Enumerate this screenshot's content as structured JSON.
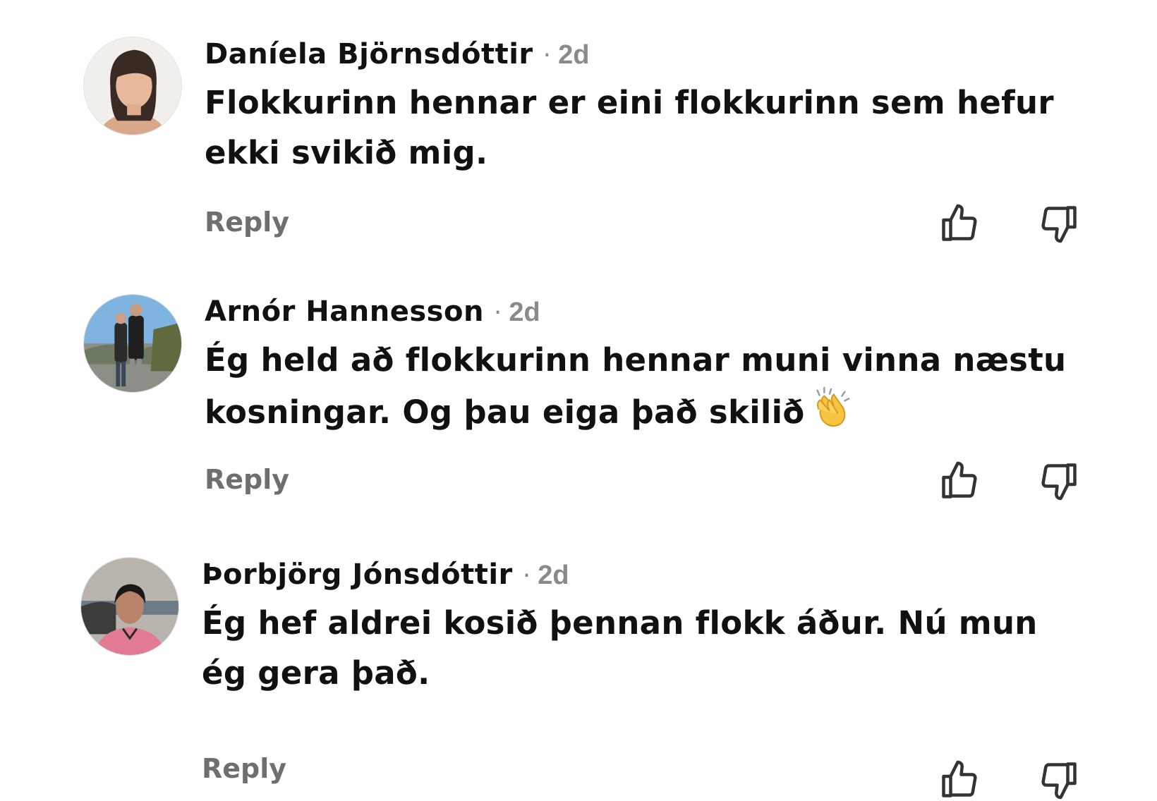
{
  "comments": [
    {
      "author": "Daníela Björnsdóttir",
      "separator": "·",
      "time": "2d",
      "text": "Flokkurinn hennar er eini flokkurinn sem hefur ekki svikið mig.",
      "reply_label": "Reply",
      "like_icon": "thumbs-up-icon",
      "dislike_icon": "thumbs-down-icon"
    },
    {
      "author": "Arnór Hannesson",
      "separator": "·",
      "time": "2d",
      "text": "Ég held að flokkurinn hennar muni vinna næstu kosningar. Og þau eiga það skilið",
      "emoji": "👏",
      "reply_label": "Reply",
      "like_icon": "thumbs-up-icon",
      "dislike_icon": "thumbs-down-icon"
    },
    {
      "author": "Þorbjörg Jónsdóttir",
      "separator": "·",
      "time": "2d",
      "text": "Ég hef aldrei kosið þennan flokk áður. Nú mun ég gera það.",
      "reply_label": "Reply",
      "like_icon": "thumbs-up-icon",
      "dislike_icon": "thumbs-down-icon"
    }
  ],
  "colors": {
    "text": "#111111",
    "meta": "#8a8a8a",
    "reply": "#6f6f6f",
    "icon": "#333333"
  }
}
